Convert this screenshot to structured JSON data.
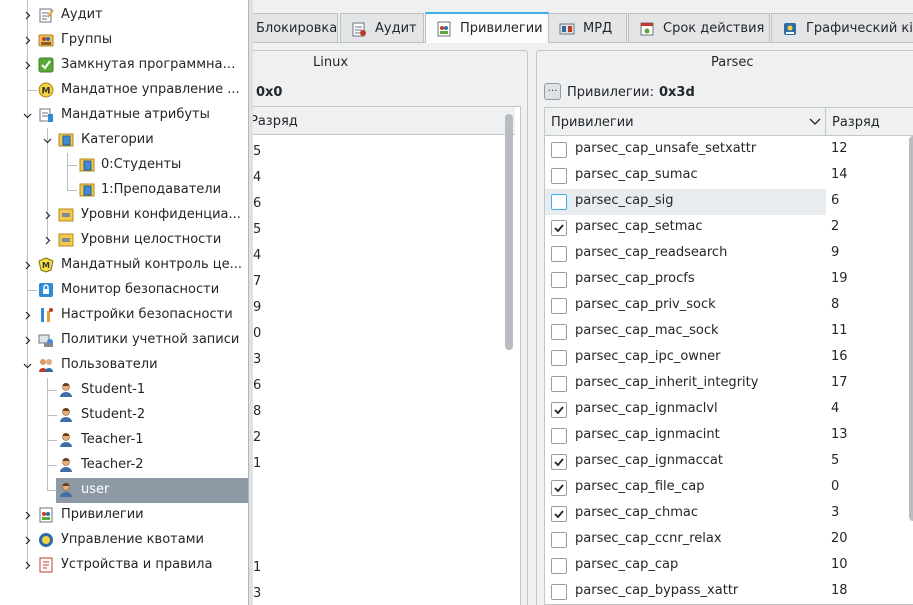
{
  "tree": {
    "items": [
      {
        "label": "Аудит",
        "level": 0,
        "expander": "collapsed",
        "icon": "audit-icon",
        "selected": false
      },
      {
        "label": "Группы",
        "level": 0,
        "expander": "collapsed",
        "icon": "groups-icon",
        "selected": false
      },
      {
        "label": "Замкнутая программная ...",
        "level": 0,
        "expander": "collapsed",
        "icon": "closed-env-icon",
        "selected": false
      },
      {
        "label": "Мандатное управление ...",
        "level": 0,
        "expander": "none",
        "icon": "mandatory-control-icon",
        "selected": false
      },
      {
        "label": "Мандатные атрибуты",
        "level": 0,
        "expander": "expanded",
        "icon": "mandatory-attrs-icon",
        "selected": false
      },
      {
        "label": "Категории",
        "level": 1,
        "expander": "expanded",
        "icon": "folder-db-icon",
        "selected": false
      },
      {
        "label": "0:Студенты",
        "level": 2,
        "expander": "none",
        "icon": "folder-db-icon",
        "selected": false
      },
      {
        "label": "1:Преподаватели",
        "level": 2,
        "expander": "none",
        "icon": "folder-db-icon",
        "selected": false
      },
      {
        "label": "Уровни конфиденциа...",
        "level": 1,
        "expander": "collapsed",
        "icon": "db-icon",
        "selected": false
      },
      {
        "label": "Уровни целостности",
        "level": 1,
        "expander": "collapsed",
        "icon": "db-icon",
        "selected": false
      },
      {
        "label": "Мандатный контроль це...",
        "level": 0,
        "expander": "collapsed",
        "icon": "integrity-control-icon",
        "selected": false
      },
      {
        "label": "Монитор безопасности",
        "level": 0,
        "expander": "none",
        "icon": "lock-icon",
        "selected": false
      },
      {
        "label": "Настройки безопасности",
        "level": 0,
        "expander": "collapsed",
        "icon": "security-settings-icon",
        "selected": false
      },
      {
        "label": "Политики учетной записи",
        "level": 0,
        "expander": "collapsed",
        "icon": "account-policy-icon",
        "selected": false
      },
      {
        "label": "Пользователи",
        "level": 0,
        "expander": "expanded",
        "icon": "users-icon",
        "selected": false
      },
      {
        "label": "Student-1",
        "level": 1,
        "expander": "none",
        "icon": "user-icon",
        "selected": false
      },
      {
        "label": "Student-2",
        "level": 1,
        "expander": "none",
        "icon": "user-icon",
        "selected": false
      },
      {
        "label": "Teacher-1",
        "level": 1,
        "expander": "none",
        "icon": "user-icon",
        "selected": false
      },
      {
        "label": "Teacher-2",
        "level": 1,
        "expander": "none",
        "icon": "user-icon",
        "selected": false
      },
      {
        "label": "user",
        "level": 1,
        "expander": "none",
        "icon": "user-icon",
        "selected": true
      },
      {
        "label": "Привилегии",
        "level": 0,
        "expander": "collapsed",
        "icon": "privileges-icon",
        "selected": false
      },
      {
        "label": "Управление квотами",
        "level": 0,
        "expander": "collapsed",
        "icon": "quota-icon",
        "selected": false
      },
      {
        "label": "Устройства и правила",
        "level": 0,
        "expander": "collapsed",
        "icon": "devices-icon",
        "selected": false
      }
    ]
  },
  "tabs": [
    {
      "label": "Блокировка",
      "icon": "",
      "active": false
    },
    {
      "label": "Аудит",
      "icon": "audit-tab-icon",
      "active": false
    },
    {
      "label": "Привилегии",
      "icon": "privileges-tab-icon",
      "active": true
    },
    {
      "label": "МРД",
      "icon": "mrd-tab-icon",
      "active": false
    },
    {
      "label": "Срок действия",
      "icon": "expiry-tab-icon",
      "active": false
    },
    {
      "label": "Графический кі",
      "icon": "graphics-tab-icon",
      "active": false
    }
  ],
  "linux": {
    "title": "Linux",
    "value": "0x0",
    "column_header": "Разряд",
    "bits": [
      "5",
      "4",
      "6",
      "5",
      "4",
      "7",
      "9",
      "0",
      "3",
      "6",
      "8",
      "2",
      "1",
      "",
      "",
      "",
      "1",
      "3"
    ]
  },
  "parsec": {
    "title": "Parsec",
    "privileges_label": "Привилегии:",
    "value": "0x3d",
    "button_glyph": "···",
    "column_privileges": "Привилегии",
    "column_bit": "Разряд",
    "rows": [
      {
        "name": "parsec_cap_unsafe_setxattr",
        "bit": "12",
        "checked": false
      },
      {
        "name": "parsec_cap_sumac",
        "bit": "14",
        "checked": false
      },
      {
        "name": "parsec_cap_sig",
        "bit": "6",
        "checked": false,
        "hover": true
      },
      {
        "name": "parsec_cap_setmac",
        "bit": "2",
        "checked": true
      },
      {
        "name": "parsec_cap_readsearch",
        "bit": "9",
        "checked": false
      },
      {
        "name": "parsec_cap_procfs",
        "bit": "19",
        "checked": false
      },
      {
        "name": "parsec_cap_priv_sock",
        "bit": "8",
        "checked": false
      },
      {
        "name": "parsec_cap_mac_sock",
        "bit": "11",
        "checked": false
      },
      {
        "name": "parsec_cap_ipc_owner",
        "bit": "16",
        "checked": false
      },
      {
        "name": "parsec_cap_inherit_integrity",
        "bit": "17",
        "checked": false
      },
      {
        "name": "parsec_cap_ignmaclvl",
        "bit": "4",
        "checked": true
      },
      {
        "name": "parsec_cap_ignmacint",
        "bit": "13",
        "checked": false
      },
      {
        "name": "parsec_cap_ignmaccat",
        "bit": "5",
        "checked": true
      },
      {
        "name": "parsec_cap_file_cap",
        "bit": "0",
        "checked": true
      },
      {
        "name": "parsec_cap_chmac",
        "bit": "3",
        "checked": true
      },
      {
        "name": "parsec_cap_ccnr_relax",
        "bit": "20",
        "checked": false
      },
      {
        "name": "parsec_cap_cap",
        "bit": "10",
        "checked": false
      },
      {
        "name": "parsec_cap_bypass_xattr",
        "bit": "18",
        "checked": false
      }
    ]
  },
  "colors": {
    "accent": "#3daee9",
    "selection": "#8d9aa6",
    "window_bg": "#eff0f1"
  }
}
